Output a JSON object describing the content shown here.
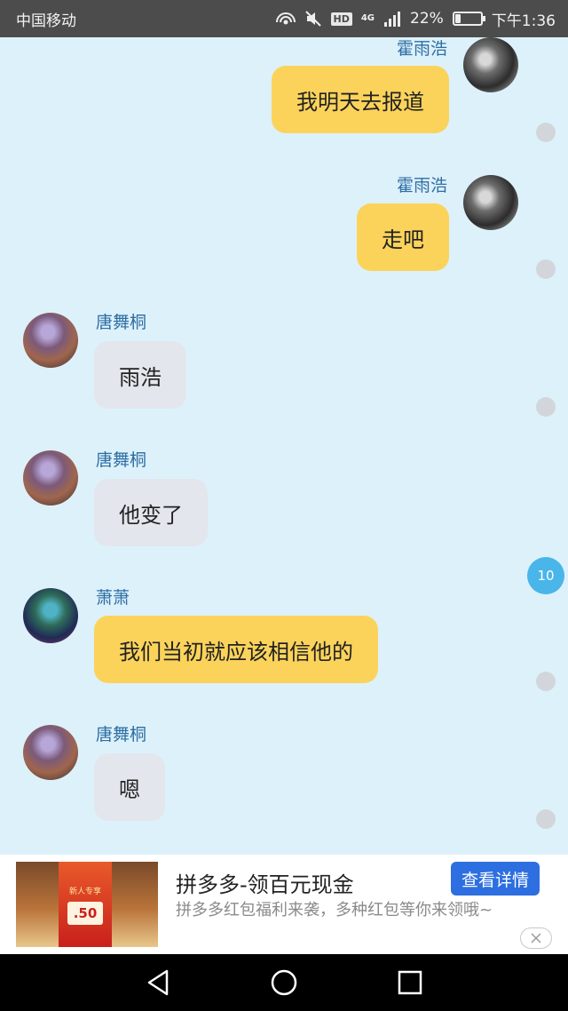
{
  "status_bar": {
    "carrier": "中国移动",
    "hd": "HD",
    "network": "4G",
    "battery_percent": "22%",
    "battery_level": 0.22,
    "time": "下午1:36",
    "icons": [
      "hotspot-icon",
      "mute-icon",
      "signal-icon",
      "battery-icon"
    ]
  },
  "chat": {
    "messages": [
      {
        "sender": "霍雨浩",
        "text": "我明天去报道",
        "side": "right",
        "bubble_color": "#fbd35b"
      },
      {
        "sender": "霍雨浩",
        "text": "走吧",
        "side": "right",
        "bubble_color": "#fbd35b"
      },
      {
        "sender": "唐舞桐",
        "text": "雨浩",
        "side": "left",
        "bubble_color": "#e3e6ec"
      },
      {
        "sender": "唐舞桐",
        "text": "他变了",
        "side": "left",
        "bubble_color": "#e3e6ec"
      },
      {
        "sender": "萧萧",
        "text": "我们当初就应该相信他的",
        "side": "left",
        "bubble_color": "#fbd35b"
      },
      {
        "sender": "唐舞桐",
        "text": "嗯",
        "side": "left",
        "bubble_color": "#e3e6ec"
      }
    ],
    "unread_count": "10"
  },
  "ad": {
    "title": "拼多多-领百元现金",
    "description": "拼多多红包福利来袭，多种红包等你来领哦~",
    "button_label": "查看详情",
    "image_amount": ".50",
    "image_caption": "新人专享"
  },
  "nav_bar": {
    "icons": [
      "back-icon",
      "home-icon",
      "recents-icon"
    ]
  },
  "colors": {
    "background": "#ddf1fb",
    "status_bar": "#4c4c4c",
    "name_color": "#2e6fa3",
    "unread_badge": "#4ab5e8",
    "ad_button": "#2d6fe0"
  }
}
